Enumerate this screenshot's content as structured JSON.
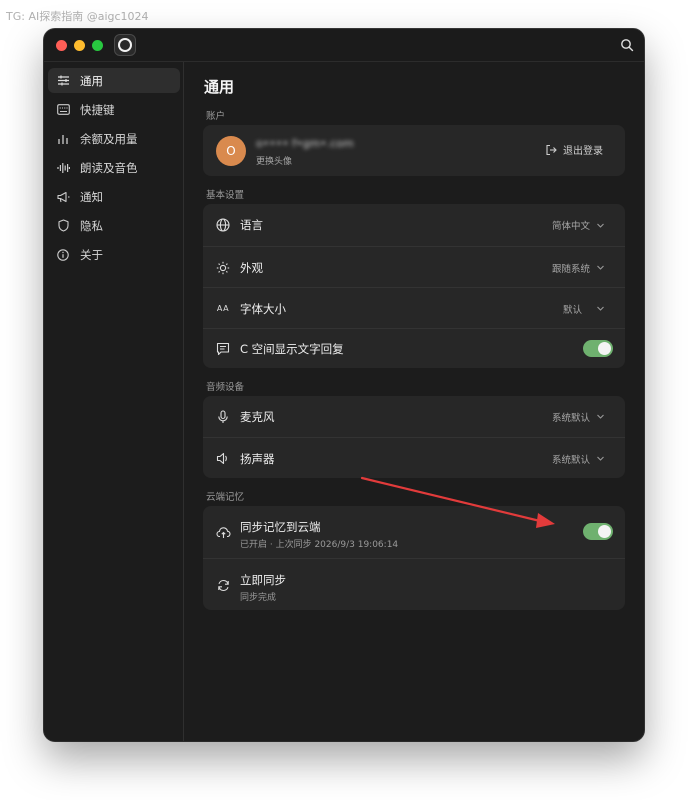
{
  "watermark": "TG: AI探索指南 @aigc1024",
  "sidebar": {
    "items": [
      {
        "label": "通用",
        "icon": "sliders-icon",
        "active": true
      },
      {
        "label": "快捷键",
        "icon": "keyboard-icon"
      },
      {
        "label": "余额及用量",
        "icon": "bar-chart-icon"
      },
      {
        "label": "朗读及音色",
        "icon": "waveform-icon"
      },
      {
        "label": "通知",
        "icon": "megaphone-icon"
      },
      {
        "label": "隐私",
        "icon": "shield-icon"
      },
      {
        "label": "关于",
        "icon": "info-icon"
      }
    ]
  },
  "main": {
    "title": "通用",
    "account": {
      "section_label": "账户",
      "avatar_letter": "O",
      "name_masked": "o•••• f•gm•.com",
      "change_avatar": "更换头像",
      "logout_label": "退出登录"
    },
    "basic": {
      "section_label": "基本设置",
      "language_label": "语言",
      "language_value": "简体中文",
      "appearance_label": "外观",
      "appearance_value": "跟随系统",
      "fontsize_label": "字体大小",
      "fontsize_value": "默认",
      "fontsize_icon_text": "AA",
      "cspace_label": "C 空间显示文字回复",
      "cspace_on": true
    },
    "audio": {
      "section_label": "音频设备",
      "mic_label": "麦克风",
      "mic_value": "系统默认",
      "speaker_label": "扬声器",
      "speaker_value": "系统默认"
    },
    "cloud": {
      "section_label": "云端记忆",
      "sync_label": "同步记忆到云端",
      "sync_status": "已开启 · 上次同步 2026/9/3 19:06:14",
      "sync_on": true,
      "sync_now_label": "立即同步",
      "sync_now_status": "同步完成"
    }
  },
  "colors": {
    "accent_toggle": "#6fb16f",
    "annotation_arrow": "#e23b3b",
    "avatar_bg": "#d98a4e"
  }
}
